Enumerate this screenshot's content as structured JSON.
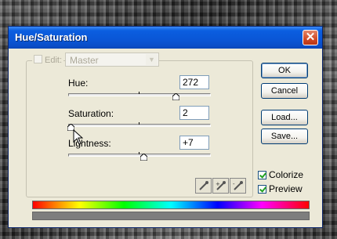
{
  "dialog": {
    "title": "Hue/Saturation",
    "close_glyph": "✕",
    "edit_label": "Edit:",
    "edit_value": "Master"
  },
  "controls": {
    "hue": {
      "label": "Hue:",
      "value": "272"
    },
    "saturation": {
      "label": "Saturation:",
      "value": "2"
    },
    "lightness": {
      "label": "Lightness:",
      "value": "+7"
    }
  },
  "buttons": {
    "ok": "OK",
    "cancel": "Cancel",
    "load": "Load...",
    "save": "Save..."
  },
  "checkboxes": {
    "colorize": {
      "label": "Colorize",
      "checked": true
    },
    "preview": {
      "label": "Preview",
      "checked": true
    }
  },
  "icons": [
    "close-icon",
    "eyedropper-icon",
    "eyedropper-plus-icon",
    "eyedropper-minus-icon",
    "chevron-down-icon",
    "mouse-pointer-icon"
  ],
  "colors": {
    "titlebar": "#0a56d6",
    "close_button": "#d24a25",
    "dialog_bg": "#ece9d8"
  }
}
